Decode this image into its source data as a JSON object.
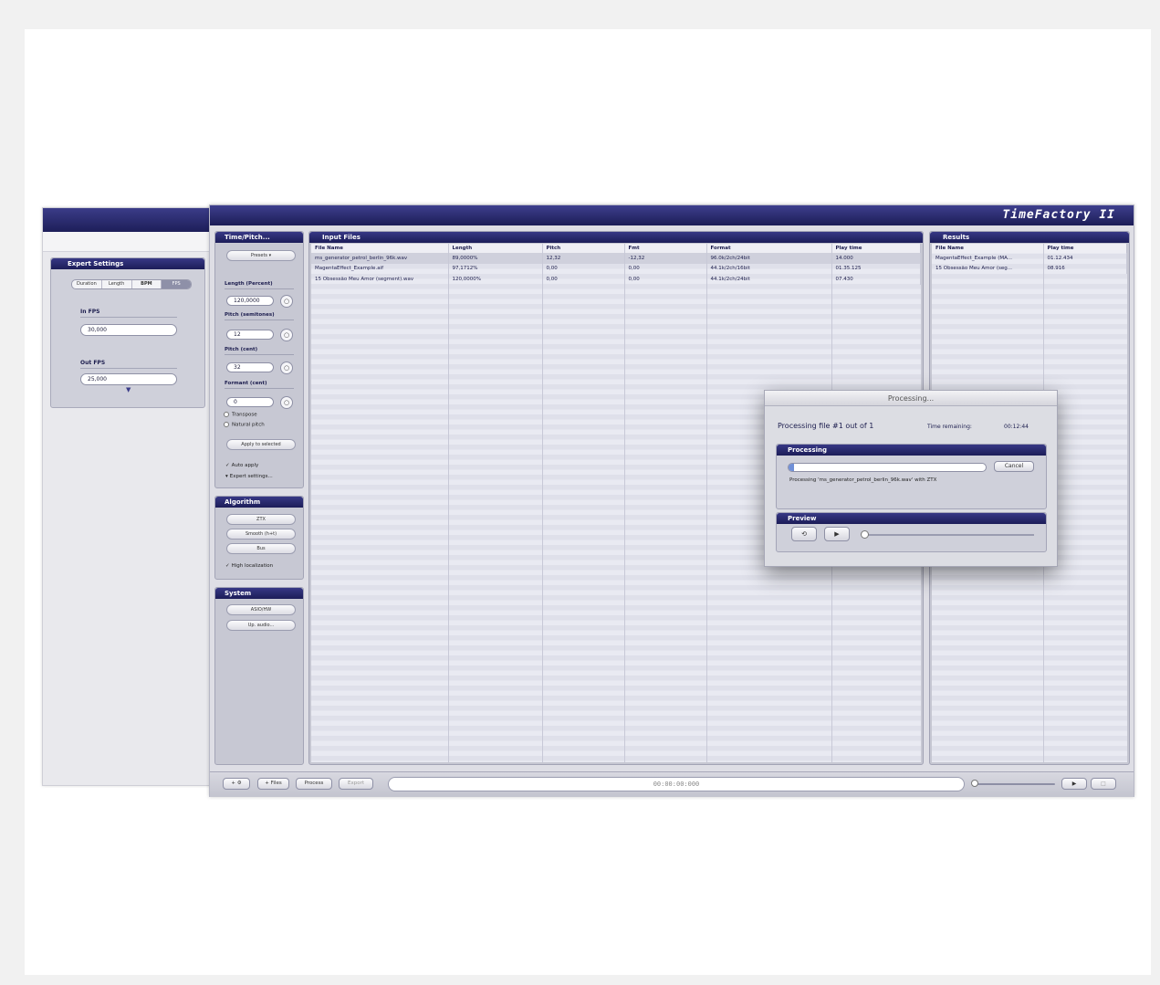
{
  "app": {
    "title": "TimeFactory II"
  },
  "expert": {
    "header": "Expert Settings",
    "modes": [
      "Duration",
      "Length",
      "BPM",
      "FPS"
    ],
    "in_fps_label": "In FPS",
    "in_fps_value": "30,000",
    "out_fps_label": "Out FPS",
    "out_fps_value": "25,000"
  },
  "time_pitch": {
    "header": "Time/Pitch...",
    "presets_label": "Presets",
    "length_label": "Length (Percent)",
    "length_value": "120,0000",
    "pitch_semi_label": "Pitch (semitones)",
    "pitch_semi_value": "12",
    "pitch_cent_label": "Pitch (cent)",
    "pitch_cent_value": "32",
    "formant_label": "Formant (cent)",
    "formant_value": "0",
    "transpose_label": "Transpose",
    "natural_pitch_label": "Natural pitch",
    "apply_label": "Apply to selected",
    "auto_apply_label": "Auto apply",
    "expert_settings_label": "Expert settings..."
  },
  "algorithm": {
    "header": "Algorithm",
    "buttons": [
      "ZTX",
      "Smooth (h+t)",
      "Bus"
    ],
    "high_localization_label": "High localization"
  },
  "system": {
    "header": "System",
    "buttons": [
      "ASIO/HW",
      "Up. audio..."
    ]
  },
  "input_files": {
    "header": "Input Files",
    "columns": [
      "File Name",
      "Length",
      "Pitch",
      "Fmt",
      "Format",
      "Play time"
    ],
    "rows": [
      [
        "ms_generator_petrol_berlin_96k.wav",
        "89,0000%",
        "12,32",
        "-12,32",
        "96.0k/2ch/24bit",
        "14.000"
      ],
      [
        "MagentaEffect_Example.aif",
        "97,1712%",
        "0,00",
        "0,00",
        "44.1k/2ch/16bit",
        "01.35.125"
      ],
      [
        "15 Obsessão Meu Amor (segment).wav",
        "120,0000%",
        "0,00",
        "0,00",
        "44.1k/2ch/24bit",
        "07.430"
      ]
    ]
  },
  "results": {
    "header": "Results",
    "columns": [
      "File Name",
      "Play time"
    ],
    "rows": [
      [
        "MagentaEffect_Example (MA...",
        "01.12.434"
      ],
      [
        "15 Obsessão Meu Amor (seg...",
        "08.916"
      ]
    ]
  },
  "bottom_bar": {
    "add_files_label": "+ Files",
    "process_label": "Process",
    "export_label": "Export",
    "timecode": "00:00:00:000",
    "play_icon": "play-icon"
  },
  "dialog": {
    "title": "Processing...",
    "message": "Processing file #1 out of 1",
    "time_remaining_label": "Time remaining:",
    "time_remaining_value": "00:12:44",
    "processing_header": "Processing",
    "progress_fraction": 0.03,
    "cancel_label": "Cancel",
    "status_text": "Processing 'ms_generator_petrol_berlin_96k.wav' with ZTX",
    "preview_header": "Preview"
  }
}
